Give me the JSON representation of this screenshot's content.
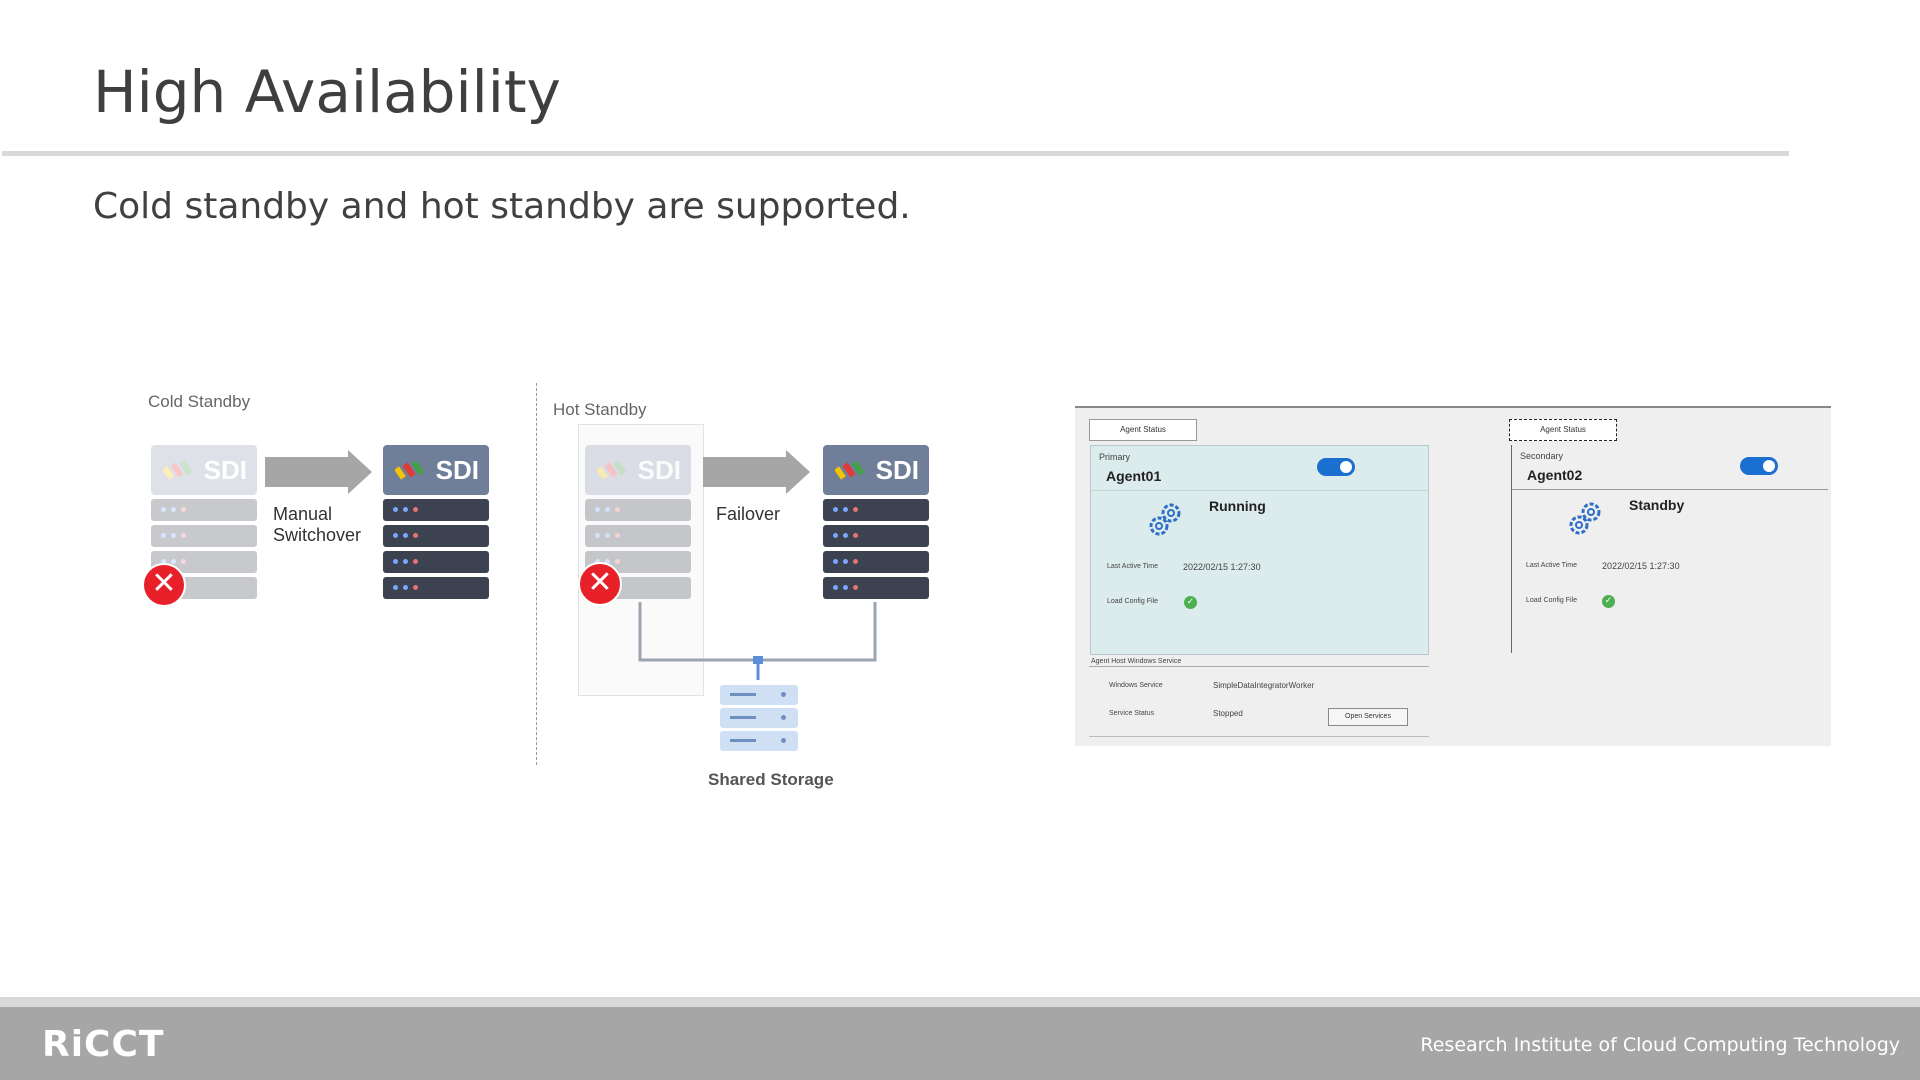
{
  "title": "High Availability",
  "subtitle": "Cold standby and hot standby are supported.",
  "diagram": {
    "cold": {
      "label": "Cold Standby",
      "action": [
        "Manual",
        "Switchover"
      ]
    },
    "hot": {
      "label": "Hot Standby",
      "action": "Failover",
      "storage_label": "Shared Storage"
    },
    "server_label": "SDI"
  },
  "agent_panel": {
    "tab_primary": "Agent Status",
    "tab_secondary": "Agent Status",
    "primary": {
      "role": "Primary",
      "name": "Agent01",
      "status": "Running",
      "last_active_label": "Last Active Time",
      "last_active_value": "2022/02/15 1:27:30",
      "config_label": "Load Config File"
    },
    "secondary": {
      "role": "Secondary",
      "name": "Agent02",
      "status": "Standby",
      "last_active_label": "Last Active Time",
      "last_active_value": "2022/02/15 1:27:30",
      "config_label": "Load Config File"
    },
    "service": {
      "section_label": "Agent Host Windows Service",
      "service_label": "Windows Service",
      "service_value": "SimpleDataIntegratorWorker",
      "state_label": "Service Status",
      "state_value": "Stopped",
      "open_button": "Open Services"
    }
  },
  "footer": {
    "logo": "RiCCT",
    "org": "Research Institute of Cloud Computing Technology"
  },
  "colors": {
    "footer_bg": "#a6a6a6",
    "server_head": "#6f7e99",
    "error_red": "#e8202a",
    "toggle_blue": "#1a6fd1"
  }
}
